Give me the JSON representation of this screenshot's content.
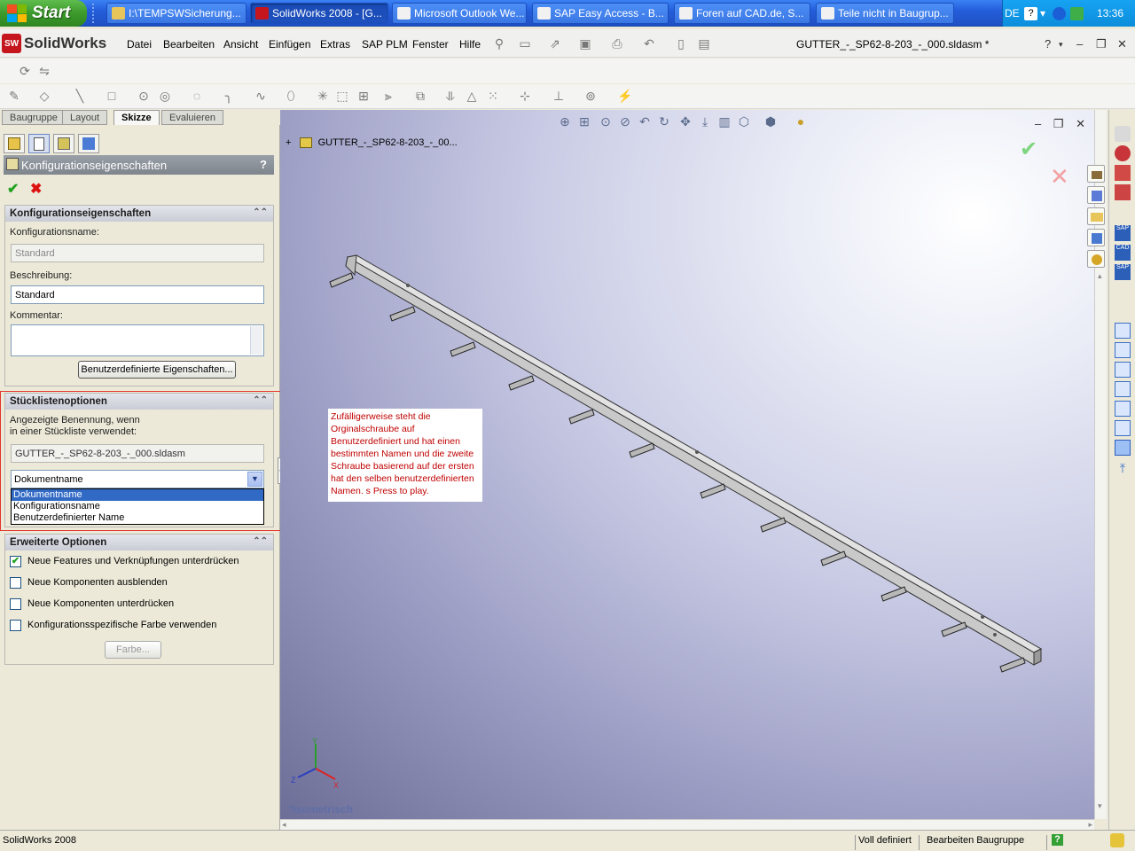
{
  "taskbar": {
    "start_label": "Start",
    "tasks": [
      {
        "label": "I:\\TEMPSWSicherung...",
        "icon_color": "#e8c55a"
      },
      {
        "label": "SolidWorks 2008 - [G...",
        "icon_color": "#c4161c"
      },
      {
        "label": "Microsoft Outlook We...",
        "icon_color": "#f1f1f1"
      },
      {
        "label": "SAP Easy Access  -  B...",
        "icon_color": "#f1f1f1"
      },
      {
        "label": "Foren auf CAD.de, S...",
        "icon_color": "#f1f1f1"
      },
      {
        "label": "Teile nicht in Baugrup...",
        "icon_color": "#f1f1f1"
      }
    ],
    "lang": "DE",
    "clock": "13:36"
  },
  "menubar": {
    "logo": "SolidWorks",
    "logo_badge": "SW",
    "items": [
      "Datei",
      "Bearbeiten",
      "Ansicht",
      "Einfügen",
      "Extras",
      "SAP PLM",
      "Fenster",
      "Hilfe"
    ],
    "doc_title": "GUTTER_-_SP62-8-203_-_000.sldasm *",
    "help_icon": "?"
  },
  "tabs": [
    "Baugruppe",
    "Layout",
    "Skizze",
    "Evaluieren"
  ],
  "panel": {
    "title": "Konfigurationseigenschaften",
    "help": "?",
    "ok": "✔",
    "cancel": "✖",
    "group1": {
      "header": "Konfigurationseigenschaften",
      "name_label": "Konfigurationsname:",
      "name_value": "Standard",
      "desc_label": "Beschreibung:",
      "desc_value": "Standard",
      "comment_label": "Kommentar:",
      "custom_button": "Benutzerdefinierte Eigenschaften..."
    },
    "group2": {
      "header": "Stücklistenoptionen",
      "label_line1": "Angezeigte Benennung, wenn",
      "label_line2": "in einer Stückliste verwendet:",
      "bom_name": "GUTTER_-_SP62-8-203_-_000.sldasm",
      "dropdown_value": "Dokumentname",
      "options": [
        "Dokumentname",
        "Konfigurationsname",
        "Benutzerdefinierter Name"
      ]
    },
    "group3": {
      "header": "Erweiterte Optionen",
      "check1": "Neue Features und Verknüpfungen unterdrücken",
      "check1_state": true,
      "check2": "Neue Komponenten ausblenden",
      "check2_state": false,
      "check3": "Neue Komponenten unterdrücken",
      "check3_state": false,
      "check4": "Konfigurationsspezifische Farbe verwenden",
      "check4_state": false,
      "color_button": "Farbe..."
    }
  },
  "viewport": {
    "tree_item": "GUTTER_-_SP62-8-203_-_00...",
    "tree_expander": "+",
    "note_lines": [
      "Zufälligerweise steht die",
      "Orginalschraube auf",
      "Benutzerdefiniert und hat einen",
      "bestimmten Namen und die zweite",
      "Schraube basierend auf der ersten",
      "hat den selben benutzerdefinierten",
      "Namen. s Press to play."
    ],
    "view_label": "*Isometrisch",
    "axis_x": "X",
    "axis_y": "Y",
    "axis_z": "Z"
  },
  "status": {
    "app": "SolidWorks 2008",
    "state": "Voll definiert",
    "mode": "Bearbeiten Baugruppe",
    "help": "?"
  },
  "colors": {
    "taskbar": "#245edb",
    "start": "#3c9a2c",
    "note_text": "#c00000",
    "highlight": "#316ac5",
    "redbox": "#e3372e"
  }
}
